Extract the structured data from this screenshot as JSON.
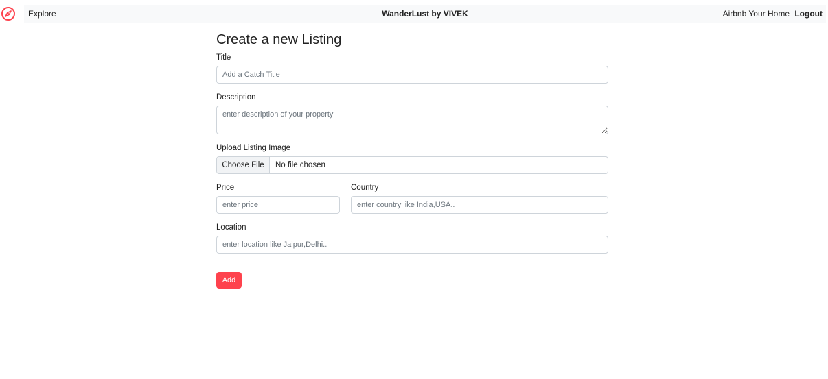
{
  "navbar": {
    "explore_label": "Explore",
    "title": "WanderLust by VIVEK",
    "host_label": "Airbnb Your Home",
    "logout_label": "Logout",
    "brand_icon": "compass-icon",
    "accent_color": "#fe424d"
  },
  "form": {
    "heading": "Create a new Listing",
    "title": {
      "label": "Title",
      "placeholder": "Add a Catch Title",
      "value": ""
    },
    "description": {
      "label": "Description",
      "placeholder": "enter description of your property",
      "value": ""
    },
    "image": {
      "label": "Upload Listing Image",
      "button_label": "Choose File",
      "status": "No file chosen"
    },
    "price": {
      "label": "Price",
      "placeholder": "enter price",
      "value": ""
    },
    "country": {
      "label": "Country",
      "placeholder": "enter country like India,USA..",
      "value": ""
    },
    "location": {
      "label": "Location",
      "placeholder": "enter location like Jaipur,Delhi..",
      "value": ""
    },
    "submit_label": "Add",
    "submit_color": "#fe424d"
  }
}
